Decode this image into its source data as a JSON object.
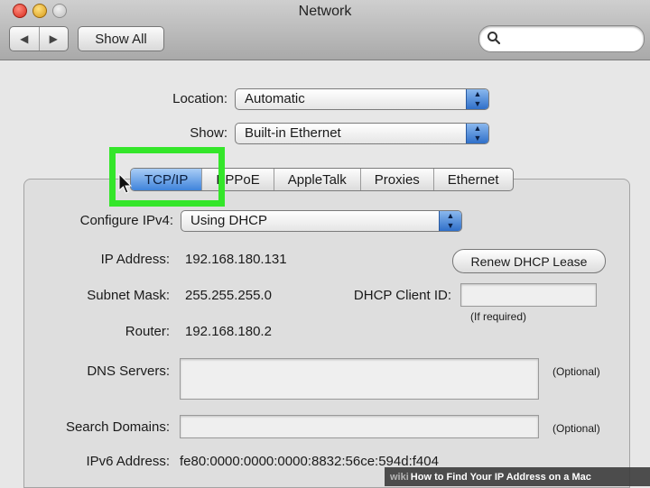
{
  "window": {
    "title": "Network"
  },
  "toolbar": {
    "back_label": "◀",
    "forward_label": "▶",
    "show_all_label": "Show All",
    "search_placeholder": ""
  },
  "location": {
    "label": "Location:",
    "value": "Automatic"
  },
  "show": {
    "label": "Show:",
    "value": "Built-in Ethernet"
  },
  "tabs": [
    {
      "label": "TCP/IP",
      "active": true
    },
    {
      "label": "PPPoE",
      "active": false
    },
    {
      "label": "AppleTalk",
      "active": false
    },
    {
      "label": "Proxies",
      "active": false
    },
    {
      "label": "Ethernet",
      "active": false
    }
  ],
  "config": {
    "configure_label": "Configure IPv4:",
    "configure_value": "Using DHCP",
    "ip_label": "IP Address:",
    "ip_value": "192.168.180.131",
    "renew_label": "Renew DHCP Lease",
    "subnet_label": "Subnet Mask:",
    "subnet_value": "255.255.255.0",
    "dhcp_client_label": "DHCP Client ID:",
    "dhcp_client_value": "",
    "dhcp_client_hint": "(If required)",
    "router_label": "Router:",
    "router_value": "192.168.180.2",
    "dns_label": "DNS Servers:",
    "dns_value": "",
    "dns_hint": "(Optional)",
    "search_domains_label": "Search Domains:",
    "search_domains_value": "",
    "search_domains_hint": "(Optional)",
    "ipv6_label": "IPv6 Address:",
    "ipv6_value": "fe80:0000:0000:0000:8832:56ce:594d:f404"
  },
  "footer": {
    "prefix": "wiki",
    "text": "How to Find Your IP Address on a Mac"
  },
  "colors": {
    "highlight": "#34e62a",
    "tab_active": "#3f83db",
    "popup_arrow": "#2f6fc9"
  }
}
